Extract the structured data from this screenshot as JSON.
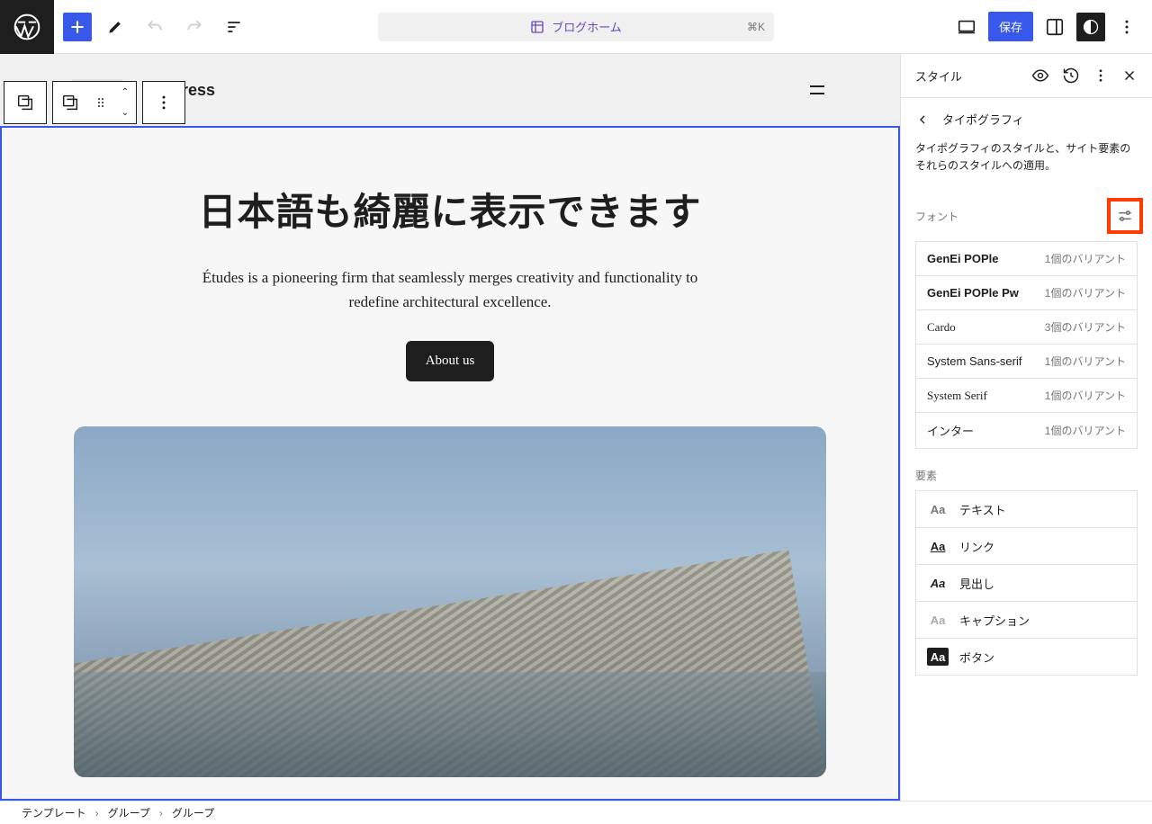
{
  "topbar": {
    "center": {
      "label": "ブログホーム",
      "kbd": "⌘K"
    },
    "save": "保存"
  },
  "canvas": {
    "siteTitle": "ress",
    "heroTitle": "日本語も綺麗に表示できます",
    "heroSub": "Études is a pioneering firm that seamlessly merges creativity and functionality to redefine architectural excellence.",
    "aboutBtn": "About us"
  },
  "panel": {
    "title": "スタイル",
    "nav": "タイポグラフィ",
    "desc": "タイポグラフィのスタイルと、サイト要素のそれらのスタイルへの適用。",
    "fontSection": "フォント",
    "fonts": [
      {
        "name": "GenEi POPle",
        "variants": "1個のバリアント",
        "cls": "bold"
      },
      {
        "name": "GenEi POPle Pw",
        "variants": "1個のバリアント",
        "cls": "bold"
      },
      {
        "name": "Cardo",
        "variants": "3個のバリアント",
        "cls": "serif"
      },
      {
        "name": "System Sans-serif",
        "variants": "1個のバリアント",
        "cls": ""
      },
      {
        "name": "System Serif",
        "variants": "1個のバリアント",
        "cls": "serif"
      },
      {
        "name": "インター",
        "variants": "1個のバリアント",
        "cls": ""
      }
    ],
    "elemSection": "要素",
    "elements": [
      {
        "label": "テキスト",
        "icon": "Aa",
        "cls": "ei-text"
      },
      {
        "label": "リンク",
        "icon": "Aa",
        "cls": "ei-link"
      },
      {
        "label": "見出し",
        "icon": "Aa",
        "cls": "ei-heading"
      },
      {
        "label": "キャプション",
        "icon": "Aa",
        "cls": "ei-caption"
      },
      {
        "label": "ボタン",
        "icon": "Aa",
        "cls": "ei-button"
      }
    ]
  },
  "breadcrumbs": [
    "テンプレート",
    "グループ",
    "グループ"
  ]
}
